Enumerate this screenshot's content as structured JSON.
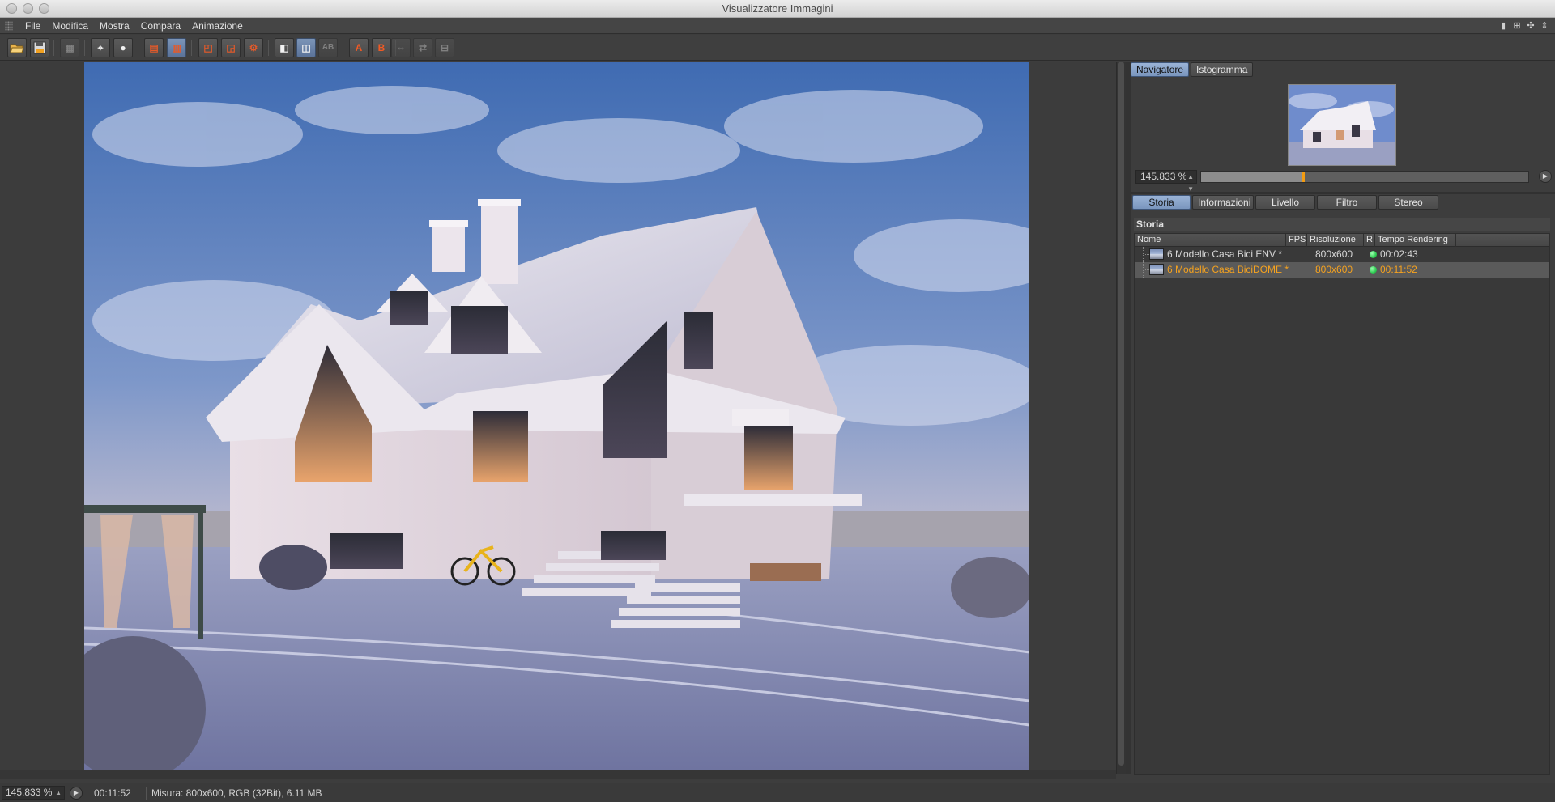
{
  "window": {
    "title": "Visualizzatore Immagini"
  },
  "menu": [
    "File",
    "Modifica",
    "Mostra",
    "Compara",
    "Animazione"
  ],
  "toolbar": {
    "compare_a_label": "A",
    "compare_b_label": "B",
    "ab_label": "AB"
  },
  "navigator": {
    "tabs": [
      "Navigatore",
      "Istogramma"
    ],
    "zoom": "145.833 %",
    "zoom_fraction": 0.31
  },
  "info_tabs": [
    "Storia",
    "Informazioni",
    "Livello",
    "Filtro",
    "Stereo"
  ],
  "history": {
    "title": "Storia",
    "columns": [
      "Nome",
      "FPS",
      "Risoluzione",
      "R",
      "Tempo Rendering"
    ],
    "rows": [
      {
        "name": "6 Modello Casa Bici ENV *",
        "fps": "",
        "resolution": "800x600",
        "time": "00:02:43",
        "selected": false
      },
      {
        "name": "6 Modello Casa BiciDOME *",
        "fps": "",
        "resolution": "800x600",
        "time": "00:11:52",
        "selected": true
      }
    ]
  },
  "statusbar": {
    "zoom": "145.833 %",
    "time": "00:11:52",
    "info": "Misura: 800x600, RGB (32Bit), 6.11 MB"
  },
  "colors": {
    "accent": "#7a96be",
    "selected_text": "#f5a21f",
    "render_ok": "#2ecc52"
  }
}
